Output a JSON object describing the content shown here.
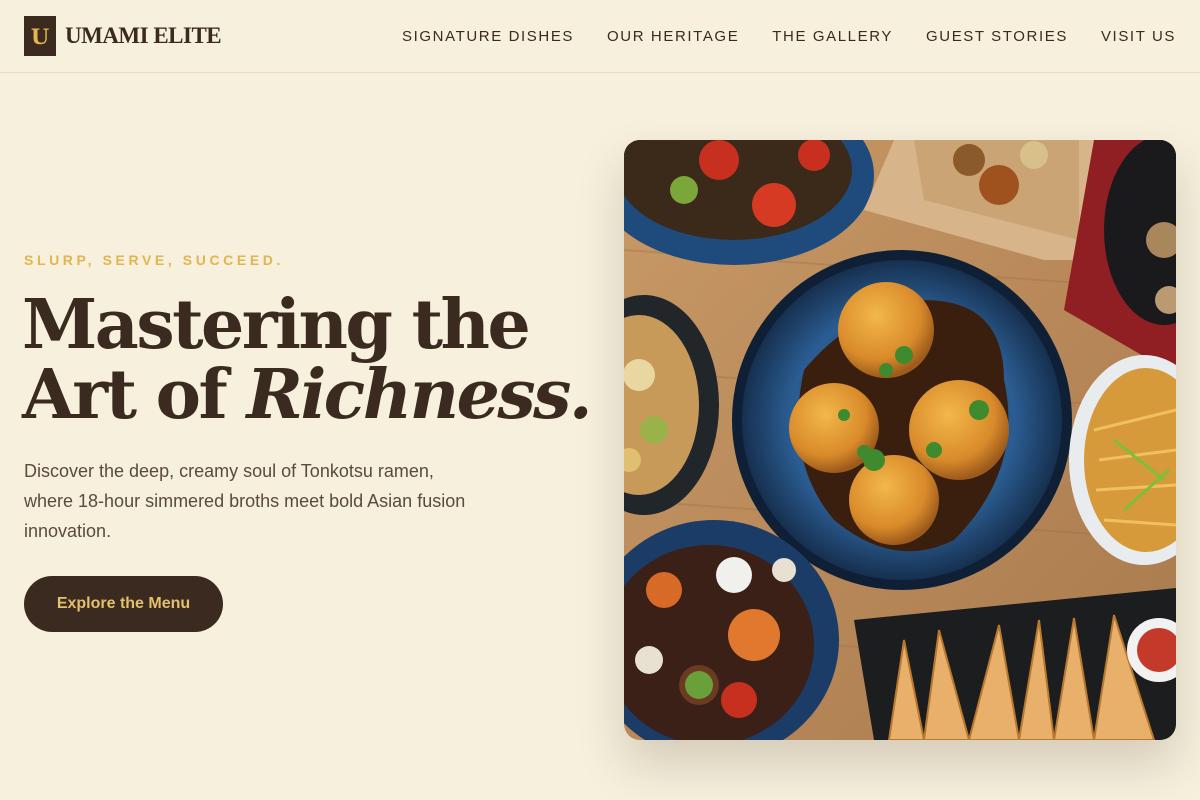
{
  "brand": {
    "mark": "U",
    "name": "UMAMI ELITE"
  },
  "nav": [
    {
      "label": "SIGNATURE DISHES"
    },
    {
      "label": "OUR HERITAGE"
    },
    {
      "label": "THE GALLERY"
    },
    {
      "label": "GUEST STORIES"
    },
    {
      "label": "VISIT US"
    }
  ],
  "hero": {
    "eyebrow": "SLURP, SERVE, SUCCEED.",
    "headline_line1": "Mastering the",
    "headline_line2_plain": "Art of ",
    "headline_line2_italic": "Richness.",
    "lede": "Discover the deep, creamy soul of Tonkotsu ramen, where 18-hour simmered broths meet bold Asian fusion innovation.",
    "cta_label": "Explore the Menu"
  },
  "colors": {
    "background": "#f6f0dd",
    "primary": "#3b2a1f",
    "accent": "#e3b54e",
    "body_text": "#5b4a3e"
  }
}
